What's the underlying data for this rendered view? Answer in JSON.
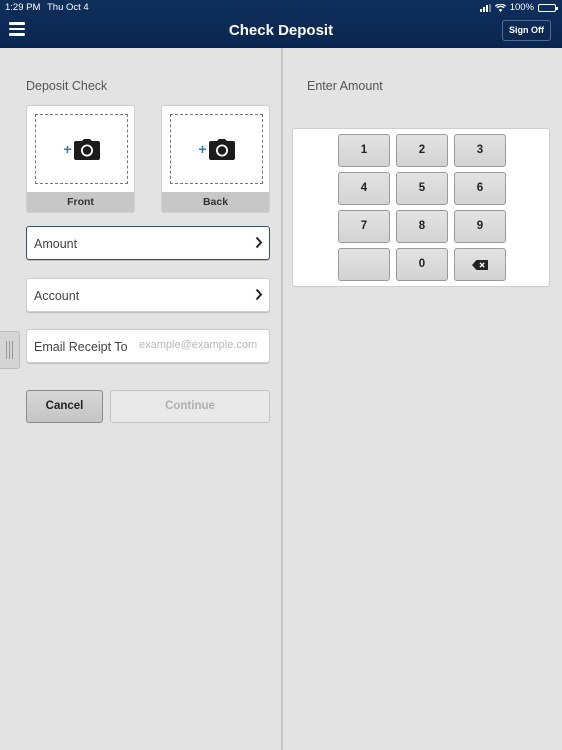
{
  "status_bar": {
    "time": "1:29 PM",
    "date": "Thu Oct 4",
    "battery": "100%"
  },
  "header": {
    "title": "Check Deposit",
    "sign_off_label": "Sign Off"
  },
  "left": {
    "section_label": "Deposit Check",
    "front_label": "Front",
    "back_label": "Back",
    "amount_label": "Amount",
    "account_label": "Account",
    "email_label": "Email Receipt To",
    "email_placeholder": "example@example.com",
    "email_value": "",
    "cancel_label": "Cancel",
    "continue_label": "Continue"
  },
  "right": {
    "section_label": "Enter Amount",
    "keys": [
      "1",
      "2",
      "3",
      "4",
      "5",
      "6",
      "7",
      "8",
      "9",
      "",
      "0",
      "backspace"
    ]
  },
  "colors": {
    "header_bg": "#0a2650",
    "accent_plus": "#2d7cc1",
    "panel_bg": "#e3e3e3"
  }
}
